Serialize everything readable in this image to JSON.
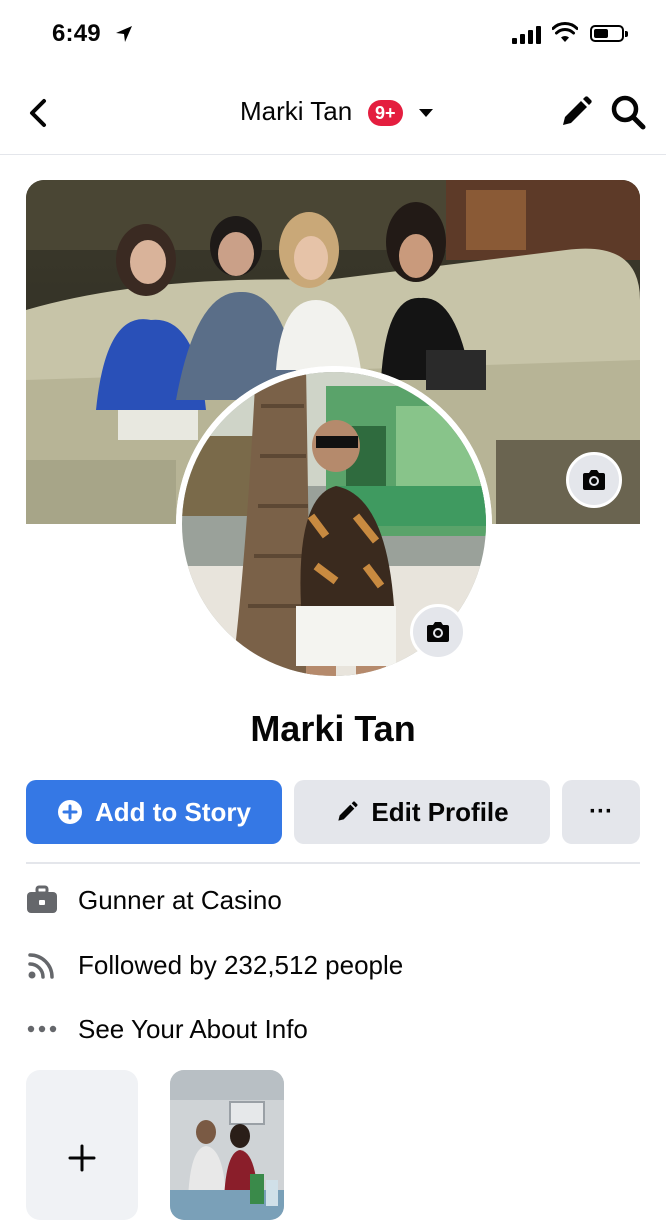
{
  "status_bar": {
    "time": "6:49"
  },
  "header": {
    "title": "Marki Tan",
    "badge": "9+"
  },
  "profile": {
    "name": "Marki Tan"
  },
  "actions": {
    "add_story": "Add to Story",
    "edit_profile": "Edit Profile",
    "more": "···"
  },
  "info": [
    {
      "icon": "briefcase-icon",
      "text": "Gunner at Casino"
    },
    {
      "icon": "rss-icon",
      "text": "Followed by 232,512 people"
    },
    {
      "icon": "more-dots-icon",
      "text": "See Your About Info"
    }
  ],
  "colors": {
    "primary": "#3578e5",
    "badge": "#e41e3f",
    "secondary_bg": "#e4e6eb"
  }
}
